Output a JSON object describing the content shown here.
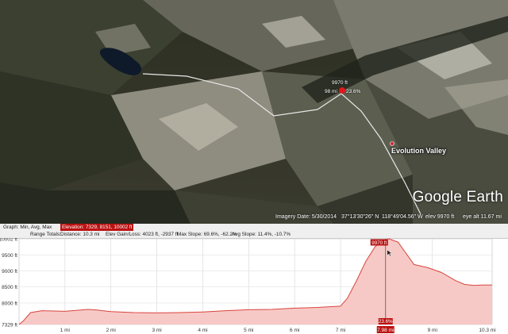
{
  "map": {
    "logo": "Google Earth",
    "place_label": "Evolution Valley",
    "marker_elevation": "9970 ft",
    "marker_distance": "98 mi",
    "marker_slope": "23.6%",
    "status": {
      "imagery_date": "Imagery Date: 5/30/2014",
      "lat": "37°13'30\"26\" N",
      "lon": "118°49'04.56\" W",
      "elev": "elev  9970 ft",
      "eye_alt": "eye alt  11.67 mi"
    }
  },
  "profile": {
    "graph_label": "Graph: Min, Avg, Max",
    "elevation_stats": "Elevation: 7329, 8151, 10002 ft",
    "range_label": "Range Totals:",
    "distance": "Distance: 10.3 mi",
    "gain_loss": "Elev Gain/Loss: 4023 ft, -2937 ft",
    "max_slope": "Max Slope: 69.6%, -62.2%",
    "avg_slope": "Avg Slope: 11.4%, -10.7%",
    "hover_elevation": "9970 ft",
    "hover_slope": "23.6%",
    "hover_distance": "7.98 mi"
  },
  "chart_data": {
    "type": "area",
    "xlabel": "",
    "ylabel": "",
    "xlim": [
      0,
      10.3
    ],
    "ylim": [
      7329,
      10002
    ],
    "y_tick_labels": [
      "10002 ft",
      "9500 ft",
      "9000 ft",
      "8500 ft",
      "8000 ft",
      "7329 ft"
    ],
    "y_tick_values": [
      10002,
      9500,
      9000,
      8500,
      8000,
      7329
    ],
    "x_tick_labels": [
      "1 mi",
      "2 mi",
      "3 mi",
      "4 mi",
      "5 mi",
      "6 mi",
      "7 mi",
      "8 mi",
      "9 mi",
      "10.3 mi"
    ],
    "x_tick_values": [
      1,
      2,
      3,
      4,
      5,
      6,
      7,
      8,
      9,
      10.3
    ],
    "x": [
      0,
      0.1,
      0.25,
      0.5,
      1.0,
      1.5,
      1.7,
      2.0,
      2.5,
      3.0,
      3.5,
      4.0,
      4.5,
      5.0,
      5.5,
      6.0,
      6.5,
      7.0,
      7.15,
      7.35,
      7.55,
      7.75,
      7.9,
      7.98,
      8.05,
      8.25,
      8.45,
      8.6,
      8.9,
      9.2,
      9.5,
      9.7,
      9.9,
      10.1,
      10.3
    ],
    "y": [
      7329,
      7450,
      7700,
      7760,
      7740,
      7800,
      7780,
      7730,
      7700,
      7690,
      7700,
      7720,
      7760,
      7790,
      7800,
      7840,
      7860,
      7900,
      8150,
      8700,
      9300,
      9750,
      9950,
      9970,
      10002,
      9900,
      9500,
      9200,
      9100,
      8950,
      8700,
      8580,
      8550,
      8560,
      8560
    ],
    "hover_x": 7.98
  }
}
